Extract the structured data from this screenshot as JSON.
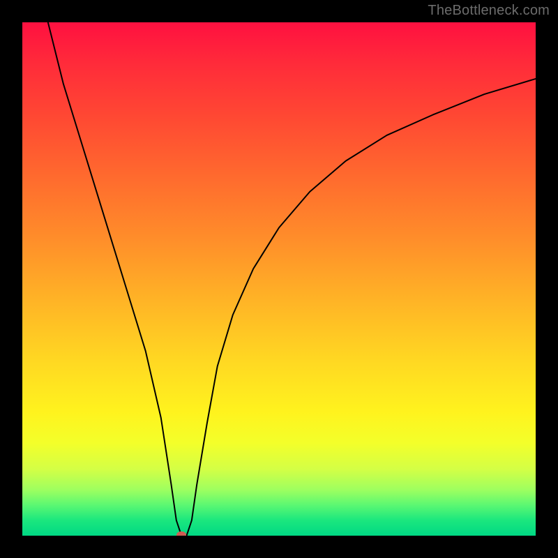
{
  "watermark": "TheBottleneck.com",
  "chart_data": {
    "type": "line",
    "title": "",
    "xlabel": "",
    "ylabel": "",
    "xlim": [
      0,
      100
    ],
    "ylim": [
      0,
      100
    ],
    "grid": false,
    "legend": null,
    "series": [
      {
        "name": "bottleneck-curve",
        "x": [
          5,
          8,
          12,
          16,
          20,
          24,
          27,
          29,
          30,
          31,
          32,
          33,
          34,
          36,
          38,
          41,
          45,
          50,
          56,
          63,
          71,
          80,
          90,
          100
        ],
        "y": [
          100,
          88,
          75,
          62,
          49,
          36,
          23,
          10,
          3,
          0,
          0,
          3,
          10,
          22,
          33,
          43,
          52,
          60,
          67,
          73,
          78,
          82,
          86,
          89
        ]
      }
    ],
    "minimum_marker": {
      "x": 31,
      "y": 0,
      "color": "#cf5d54"
    },
    "background_gradient": {
      "orientation": "vertical",
      "stops": [
        {
          "pos": 0.0,
          "color": "#ff1040"
        },
        {
          "pos": 0.3,
          "color": "#ff6a2e"
        },
        {
          "pos": 0.66,
          "color": "#ffd822"
        },
        {
          "pos": 0.82,
          "color": "#f3ff2a"
        },
        {
          "pos": 1.0,
          "color": "#00d884"
        }
      ]
    }
  }
}
